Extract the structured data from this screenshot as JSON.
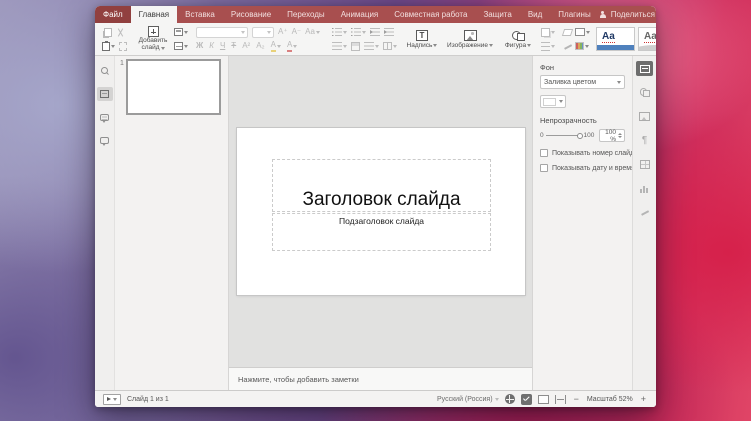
{
  "header": {
    "tabs": [
      "Файл",
      "Главная",
      "Вставка",
      "Рисование",
      "Переходы",
      "Анимация",
      "Совместная работа",
      "Защита",
      "Вид",
      "Плагины"
    ],
    "share": "Поделиться"
  },
  "toolbar": {
    "add_slide_line1": "Добавить",
    "add_slide_line2": "слайд",
    "font": {
      "bold": "Ж",
      "italic": "К",
      "underline": "Ч",
      "strike": "Ŧ",
      "superscript": "А²",
      "subscript": "А₂",
      "increase": "А⁺",
      "decrease": "А⁻",
      "case": "Аа",
      "color": "А"
    },
    "insert": {
      "textbox": "Надпись",
      "image": "Изображение",
      "shape": "Фигура",
      "textbox_glyph": "Т"
    },
    "themes": {
      "tile_label": "Aa"
    }
  },
  "slide_panel": {
    "slide_number": "1"
  },
  "canvas": {
    "title_placeholder": "Заголовок слайда",
    "subtitle_placeholder": "Подзаголовок слайда"
  },
  "notes": {
    "placeholder": "Нажмите, чтобы добавить заметки"
  },
  "sidebar": {
    "background_label": "Фон",
    "fill_type_value": "Заливка цветом",
    "opacity_label": "Непрозрачность",
    "opacity_min": "0",
    "opacity_max": "100",
    "opacity_value": "100 %",
    "checkbox_slide_number": "Показывать номер слайда",
    "checkbox_date_time": "Показывать дату и время"
  },
  "right_rail": {
    "paragraph_glyph": "¶"
  },
  "statusbar": {
    "slide_counter": "Слайд 1 из 1",
    "language": "Русский (Россия)",
    "zoom_out": "−",
    "zoom_label": "Масштаб 52%",
    "zoom_in": "+"
  },
  "colors": {
    "titlebar": "#a84f4f",
    "titlebar_file_tab": "#91403f",
    "theme_accent_blue": "#4f81bd"
  }
}
